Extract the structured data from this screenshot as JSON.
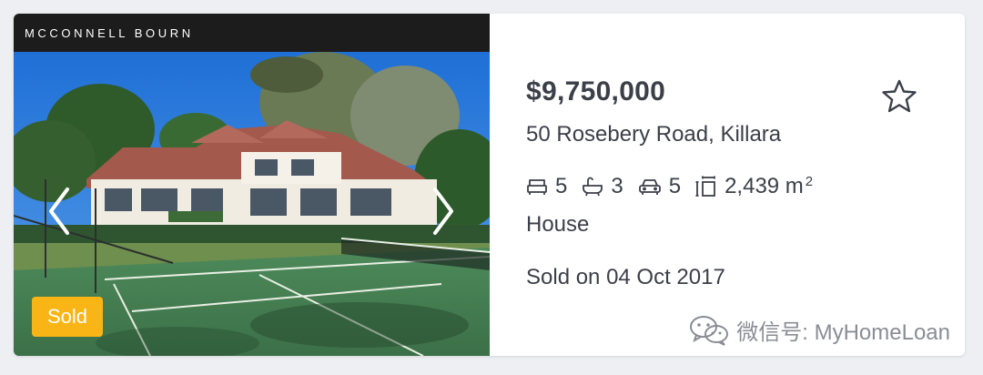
{
  "listing": {
    "agency": "MCCONNELL BOURN",
    "badge": "Sold",
    "price": "$9,750,000",
    "address": "50 Rosebery Road, Killara",
    "features": {
      "bedrooms": "5",
      "bathrooms": "3",
      "parking": "5",
      "land_size": "2,439 m",
      "land_unit_sup": "2"
    },
    "property_type": "House",
    "sold_date": "Sold on 04 Oct 2017"
  },
  "icons": {
    "bed": "bed-icon",
    "bath": "bath-icon",
    "car": "car-icon",
    "land": "land-size-icon",
    "favourite": "star-outline-icon",
    "prev": "chevron-left-icon",
    "next": "chevron-right-icon",
    "wechat": "wechat-icon"
  },
  "watermark": {
    "text": "微信号: MyHomeLoan"
  },
  "colors": {
    "badge": "#f9b515",
    "text": "#3b3f48",
    "agency_bar": "#1c1c1c"
  }
}
